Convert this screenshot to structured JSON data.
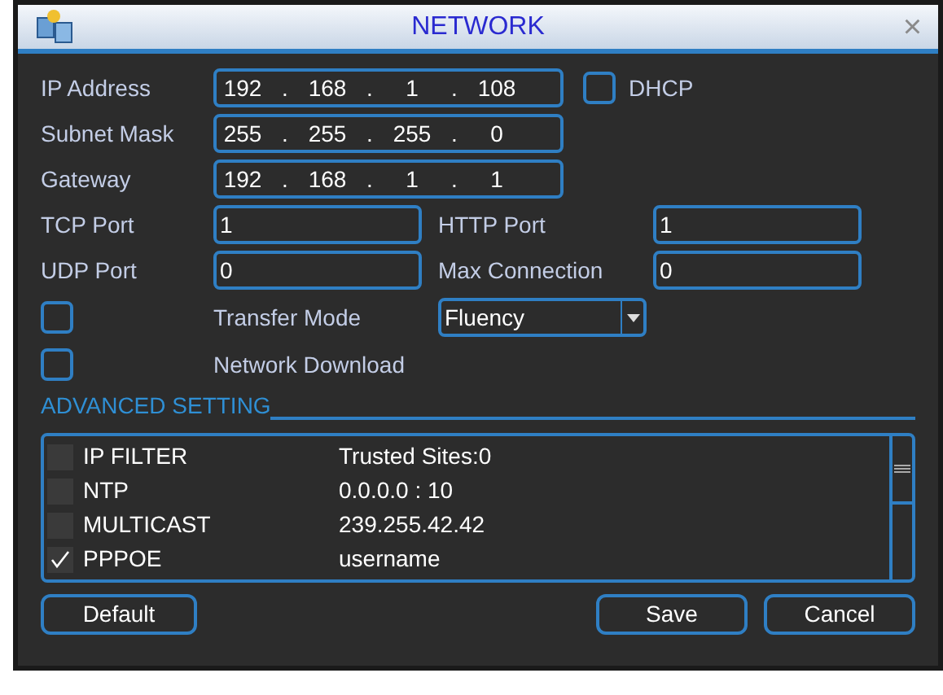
{
  "window": {
    "title": "NETWORK",
    "close": "×"
  },
  "ip_address": {
    "label": "IP Address",
    "octets": [
      "192",
      "168",
      "1",
      "108"
    ],
    "separator": "."
  },
  "dhcp": {
    "label": "DHCP",
    "checked": false
  },
  "subnet_mask": {
    "label": "Subnet Mask",
    "octets": [
      "255",
      "255",
      "255",
      "0"
    ],
    "separator": "."
  },
  "gateway": {
    "label": "Gateway",
    "octets": [
      "192",
      "168",
      "1",
      "1"
    ],
    "separator": "."
  },
  "tcp_port": {
    "label": "TCP Port",
    "value": "1"
  },
  "http_port": {
    "label": "HTTP Port",
    "value": "1"
  },
  "udp_port": {
    "label": "UDP Port",
    "value": "0"
  },
  "max_connection": {
    "label": "Max Connection",
    "value": "0"
  },
  "transfer_mode": {
    "label": "Transfer Mode",
    "checked": false,
    "value": "Fluency"
  },
  "network_download": {
    "label": "Network Download",
    "checked": false
  },
  "advanced_setting": {
    "title": "ADVANCED SETTING",
    "rows": [
      {
        "name": "IP FILTER",
        "value": "Trusted Sites:0",
        "checked": false
      },
      {
        "name": "NTP",
        "value": "0.0.0.0 : 10",
        "checked": false
      },
      {
        "name": "MULTICAST",
        "value": "239.255.42.42",
        "checked": false
      },
      {
        "name": "PPPOE",
        "value": "username",
        "checked": true
      }
    ]
  },
  "buttons": [
    {
      "label": "Default",
      "kind": "left"
    },
    {
      "label": "Save",
      "kind": "right"
    },
    {
      "label": "Cancel",
      "kind": "right"
    }
  ]
}
